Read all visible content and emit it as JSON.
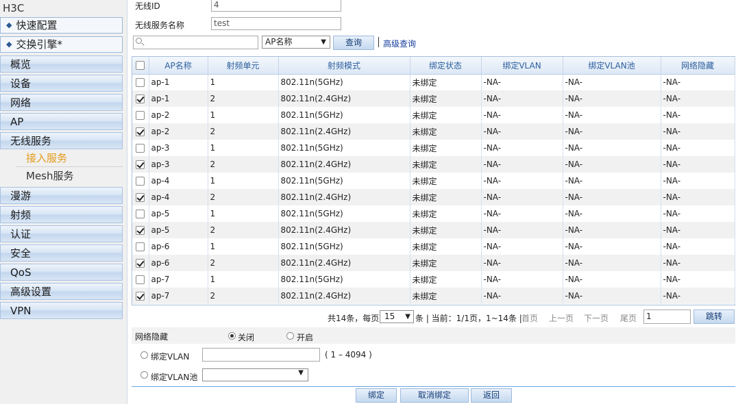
{
  "sidebar": {
    "brand": "H3C",
    "quick": [
      {
        "label": "快速配置"
      },
      {
        "label": "交换引擎*"
      }
    ],
    "nav_top": [
      {
        "label": "概览"
      },
      {
        "label": "设备"
      },
      {
        "label": "网络"
      },
      {
        "label": "AP"
      },
      {
        "label": "无线服务"
      }
    ],
    "sub_items": [
      {
        "label": "接入服务",
        "active": true
      },
      {
        "label": "Mesh服务",
        "active": false
      }
    ],
    "nav_bottom": [
      {
        "label": "漫游"
      },
      {
        "label": "射频"
      },
      {
        "label": "认证"
      },
      {
        "label": "安全"
      },
      {
        "label": "QoS"
      },
      {
        "label": "高级设置"
      },
      {
        "label": "VPN"
      }
    ]
  },
  "form": {
    "wireless_id_label": "无线ID",
    "wireless_id_value": "4",
    "service_name_label": "无线服务名称",
    "service_name_value": "test"
  },
  "search": {
    "value": "",
    "field": "AP名称",
    "query_button": "查询",
    "advanced_link": "高级查询"
  },
  "table": {
    "columns": [
      "AP名称",
      "射频单元",
      "射频模式",
      "绑定状态",
      "绑定VLAN",
      "绑定VLAN池",
      "网络隐藏"
    ],
    "rows": [
      {
        "checked": false,
        "ap": "ap-1",
        "radio": "1",
        "mode": "802.11n(5GHz)",
        "status": "未绑定",
        "vlan": "-NA-",
        "vlan_pool": "-NA-",
        "hidden": "-NA-"
      },
      {
        "checked": true,
        "ap": "ap-1",
        "radio": "2",
        "mode": "802.11n(2.4GHz)",
        "status": "未绑定",
        "vlan": "-NA-",
        "vlan_pool": "-NA-",
        "hidden": "-NA-"
      },
      {
        "checked": false,
        "ap": "ap-2",
        "radio": "1",
        "mode": "802.11n(5GHz)",
        "status": "未绑定",
        "vlan": "-NA-",
        "vlan_pool": "-NA-",
        "hidden": "-NA-"
      },
      {
        "checked": true,
        "ap": "ap-2",
        "radio": "2",
        "mode": "802.11n(2.4GHz)",
        "status": "未绑定",
        "vlan": "-NA-",
        "vlan_pool": "-NA-",
        "hidden": "-NA-"
      },
      {
        "checked": false,
        "ap": "ap-3",
        "radio": "1",
        "mode": "802.11n(5GHz)",
        "status": "未绑定",
        "vlan": "-NA-",
        "vlan_pool": "-NA-",
        "hidden": "-NA-"
      },
      {
        "checked": true,
        "ap": "ap-3",
        "radio": "2",
        "mode": "802.11n(2.4GHz)",
        "status": "未绑定",
        "vlan": "-NA-",
        "vlan_pool": "-NA-",
        "hidden": "-NA-"
      },
      {
        "checked": false,
        "ap": "ap-4",
        "radio": "1",
        "mode": "802.11n(5GHz)",
        "status": "未绑定",
        "vlan": "-NA-",
        "vlan_pool": "-NA-",
        "hidden": "-NA-"
      },
      {
        "checked": true,
        "ap": "ap-4",
        "radio": "2",
        "mode": "802.11n(2.4GHz)",
        "status": "未绑定",
        "vlan": "-NA-",
        "vlan_pool": "-NA-",
        "hidden": "-NA-"
      },
      {
        "checked": false,
        "ap": "ap-5",
        "radio": "1",
        "mode": "802.11n(5GHz)",
        "status": "未绑定",
        "vlan": "-NA-",
        "vlan_pool": "-NA-",
        "hidden": "-NA-"
      },
      {
        "checked": true,
        "ap": "ap-5",
        "radio": "2",
        "mode": "802.11n(2.4GHz)",
        "status": "未绑定",
        "vlan": "-NA-",
        "vlan_pool": "-NA-",
        "hidden": "-NA-"
      },
      {
        "checked": false,
        "ap": "ap-6",
        "radio": "1",
        "mode": "802.11n(5GHz)",
        "status": "未绑定",
        "vlan": "-NA-",
        "vlan_pool": "-NA-",
        "hidden": "-NA-"
      },
      {
        "checked": true,
        "ap": "ap-6",
        "radio": "2",
        "mode": "802.11n(2.4GHz)",
        "status": "未绑定",
        "vlan": "-NA-",
        "vlan_pool": "-NA-",
        "hidden": "-NA-"
      },
      {
        "checked": false,
        "ap": "ap-7",
        "radio": "1",
        "mode": "802.11n(5GHz)",
        "status": "未绑定",
        "vlan": "-NA-",
        "vlan_pool": "-NA-",
        "hidden": "-NA-"
      },
      {
        "checked": true,
        "ap": "ap-7",
        "radio": "2",
        "mode": "802.11n(2.4GHz)",
        "status": "未绑定",
        "vlan": "-NA-",
        "vlan_pool": "-NA-",
        "hidden": "-NA-"
      }
    ]
  },
  "pager": {
    "total_prefix": "共14条，每页",
    "page_size": "15",
    "current": "条 | 当前：1/1页，1~14条 |",
    "first": "首页",
    "prev": "上一页",
    "next": "下一页",
    "last": "尾页",
    "page_input": "1",
    "jump": "跳转"
  },
  "bind_form": {
    "network_hide_label": "网络隐藏",
    "off_label": "关闭",
    "on_label": "开启",
    "bind_vlan_label": "绑定VLAN",
    "vlan_value": "",
    "vlan_range": "( 1 – 4094 )",
    "bind_vlan_pool_label": "绑定VLAN池",
    "vlan_pool_value": ""
  },
  "actions": {
    "bind": "绑定",
    "unbind": "取消绑定",
    "back": "返回"
  },
  "colors": {
    "accent": "#2c5f9e",
    "active_sub": "#e39a18",
    "divider": "#69a7e3"
  }
}
